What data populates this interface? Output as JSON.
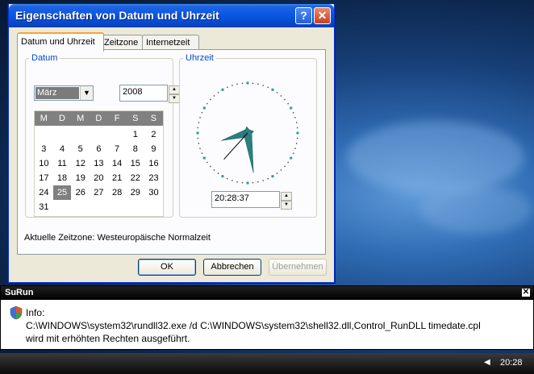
{
  "dialog": {
    "title": "Eigenschaften von Datum und Uhrzeit",
    "help_glyph": "?",
    "close_glyph": "✕",
    "tabs": [
      "Datum und Uhrzeit",
      "Zeitzone",
      "Internetzeit"
    ],
    "date_group_label": "Datum",
    "month": "März",
    "year": "2008",
    "weekdays": [
      "M",
      "D",
      "M",
      "D",
      "F",
      "S",
      "S"
    ],
    "days": [
      "",
      "",
      "",
      "",
      "",
      "1",
      "2",
      "3",
      "4",
      "5",
      "6",
      "7",
      "8",
      "9",
      "10",
      "11",
      "12",
      "13",
      "14",
      "15",
      "16",
      "17",
      "18",
      "19",
      "20",
      "21",
      "22",
      "23",
      "24",
      "25",
      "26",
      "27",
      "28",
      "29",
      "30",
      "31"
    ],
    "selected_day": "25",
    "time_group_label": "Uhrzeit",
    "time": "20:28:37",
    "clock": {
      "hours": 20,
      "minutes": 28,
      "seconds": 37
    },
    "timezone_text": "Aktuelle Zeitzone: Westeuropäische Normalzeit",
    "ok_label": "OK",
    "cancel_label": "Abbrechen",
    "apply_label": "Übernehmen"
  },
  "surun": {
    "title": "SuRun",
    "close_glyph": "✕",
    "info_label": "Info:",
    "command": "C:\\WINDOWS\\system32\\rundll32.exe /d C:\\WINDOWS\\system32\\shell32.dll,Control_RunDLL timedate.cpl",
    "message": "wird mit erhöhten Rechten ausgeführt.",
    "icon": "uac-shield-icon"
  },
  "taskbar": {
    "tray_arrow": "◀",
    "clock": "20:28"
  },
  "colors": {
    "title_blue": "#0a58e4",
    "legend_blue": "#0046d5",
    "clock_hands": "#2a7f7f",
    "tab_highlight": "#f5a634"
  }
}
